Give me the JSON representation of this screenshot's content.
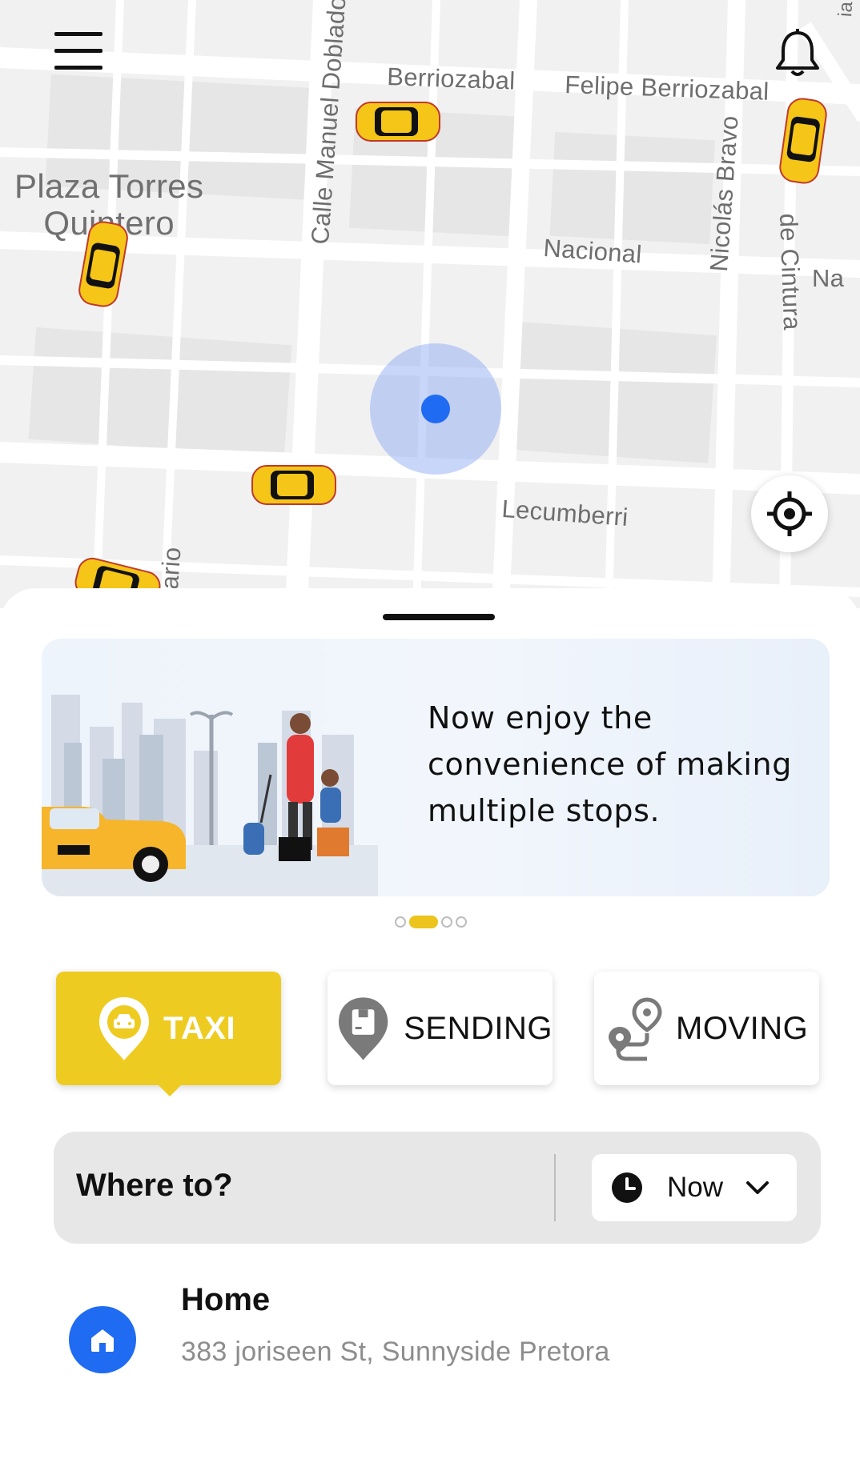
{
  "map": {
    "streets": {
      "berriozabal": "Berriozabal",
      "felipe_berriozabal": "Felipe Berriozabal",
      "calle_manuel_doblado": "Calle Manuel Doblado",
      "plaza_torres_quintero": "Plaza Torres\nQuintero",
      "nacional": "Nacional",
      "nicolas_bravo": "Nicolás Bravo",
      "de_cintura": "de Cintura",
      "na": "Na",
      "lecumberri": "Lecumberri",
      "ario": "ario",
      "ia": "ia"
    },
    "colors": {
      "background": "#f1f1f1",
      "road": "#ffffff",
      "user_location": "#1f6bf2",
      "taxi": "#f5c518"
    },
    "icons": {
      "menu": "hamburger-menu-icon",
      "notifications": "bell-icon",
      "locate": "crosshair-icon"
    }
  },
  "banner": {
    "text": "Now enjoy the convenience of making multiple stops.",
    "pages": 4,
    "active_page": 2
  },
  "services": [
    {
      "id": "taxi",
      "label": "TAXI",
      "icon": "taxi-pin-icon",
      "selected": true
    },
    {
      "id": "sending",
      "label": "SENDING",
      "icon": "package-pin-icon",
      "selected": false
    },
    {
      "id": "moving",
      "label": "MOVING",
      "icon": "route-icon",
      "selected": false
    }
  ],
  "search": {
    "label": "Where to?",
    "time": {
      "value": "Now",
      "icon": "clock-icon",
      "dropdown_icon": "chevron-down-icon"
    }
  },
  "saved_places": [
    {
      "name": "Home",
      "address": "383 joriseen St, Sunnyside Pretora",
      "icon": "home-icon"
    }
  ],
  "colors": {
    "accent": "#eecb21",
    "primary_blue": "#1f6bf2",
    "text": "#111111",
    "muted_text": "#8d8d8d"
  }
}
